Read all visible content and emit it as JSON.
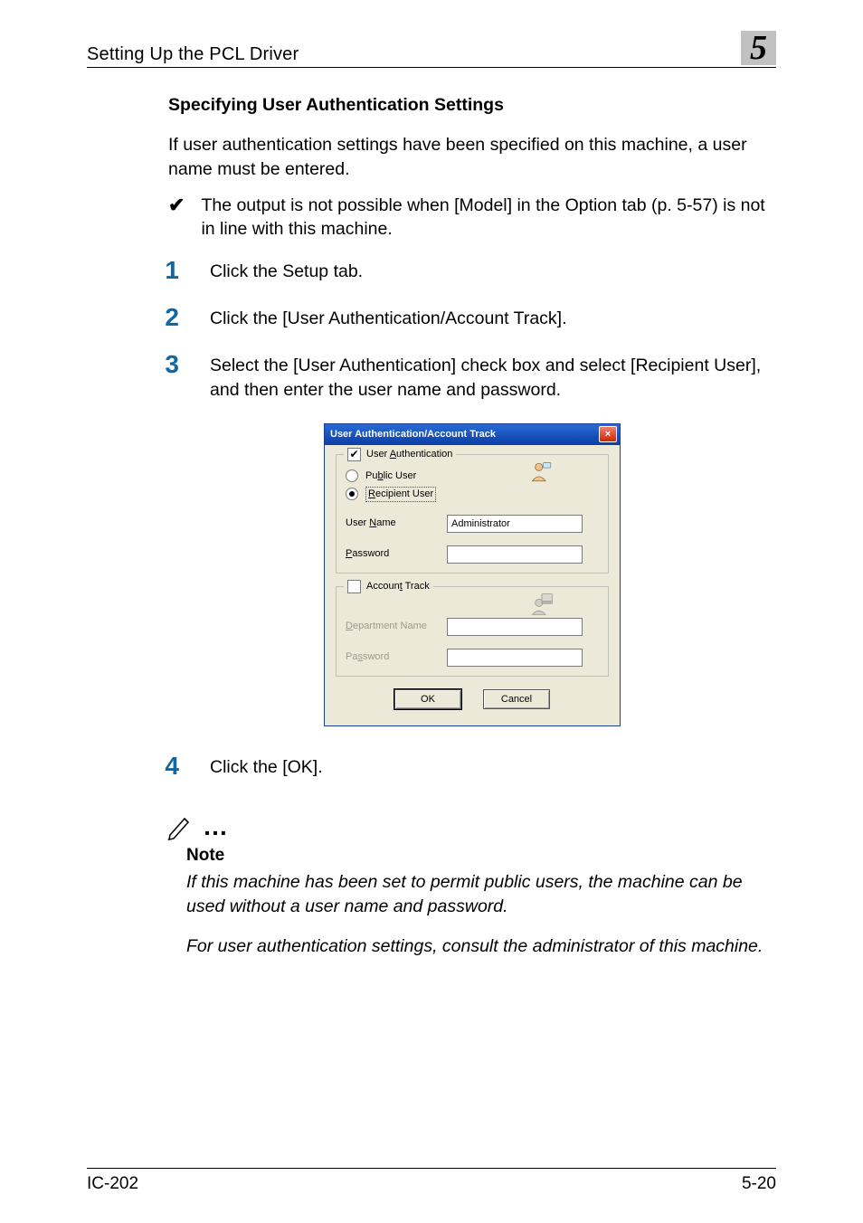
{
  "header": {
    "title": "Setting Up the PCL Driver",
    "chapter": "5"
  },
  "section_heading": "Specifying User Authentication Settings",
  "intro": "If user authentication settings have been specified on this machine, a user name must be entered.",
  "bullet": "The output is not possible when [Model] in the Option tab (p. 5-57) is not in line with this machine.",
  "steps": {
    "s1": "Click the Setup tab.",
    "s2": "Click the [User Authentication/Account Track].",
    "s3": "Select the [User Authentication] check box and select [Recipient User], and then enter the user name and password.",
    "s4": "Click the [OK]."
  },
  "dialog": {
    "title": "User Authentication/Account Track",
    "user_auth_label_pre": "User ",
    "user_auth_label_u": "A",
    "user_auth_label_post": "uthentication",
    "public_pre": "Pu",
    "public_u": "b",
    "public_post": "lic User",
    "recipient_u": "R",
    "recipient_post": "ecipient User",
    "username_pre": "User ",
    "username_u": "N",
    "username_post": "ame",
    "username_value": "Administrator",
    "password_u": "P",
    "password_post": "assword",
    "account_pre": "Accoun",
    "account_u": "t",
    "account_post": " Track",
    "dept_u": "D",
    "dept_post": "epartment Name",
    "password2_pre": "Pa",
    "password2_u": "s",
    "password2_post": "sword",
    "ok": "OK",
    "cancel": "Cancel"
  },
  "note": {
    "heading": "Note",
    "p1": "If this machine has been set to permit public users, the machine can be used without a user name and password.",
    "p2": "For user authentication settings, consult the administrator of this machine."
  },
  "footer": {
    "left": "IC-202",
    "right": "5-20"
  }
}
